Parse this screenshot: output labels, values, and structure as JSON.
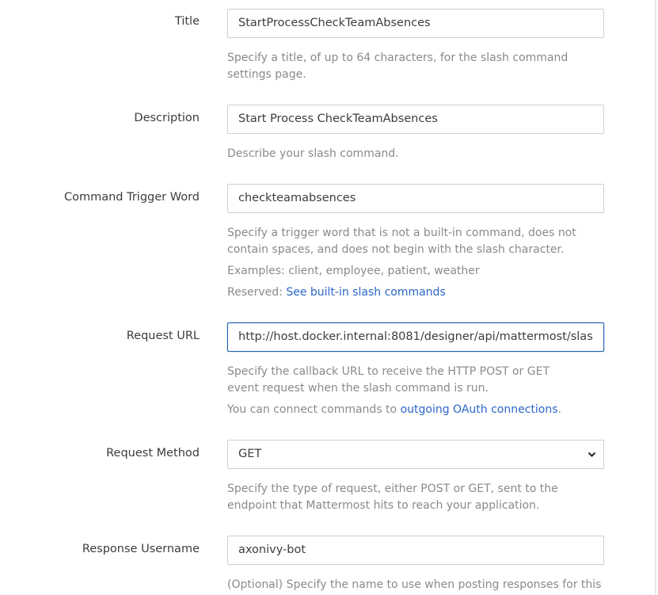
{
  "fields": {
    "title": {
      "label": "Title",
      "value": "StartProcessCheckTeamAbsences",
      "help": "Specify a title, of up to 64 characters, for the slash command settings page."
    },
    "description": {
      "label": "Description",
      "value": "Start Process CheckTeamAbsences",
      "help": "Describe your slash command."
    },
    "trigger": {
      "label": "Command Trigger Word",
      "value": "checkteamabsences",
      "help": "Specify a trigger word that is not a built-in command, does not contain spaces, and does not begin with the slash character.",
      "examples": "Examples: client, employee, patient, weather",
      "reserved_prefix": "Reserved: ",
      "reserved_link": "See built-in slash commands"
    },
    "request_url": {
      "label": "Request URL",
      "value": "http://host.docker.internal:8081/designer/api/mattermost/slas",
      "help": "Specify the callback URL to receive the HTTP POST or GET event request when the slash command is run.",
      "connect_prefix": "You can connect commands to ",
      "connect_link": "outgoing OAuth connections",
      "connect_suffix": "."
    },
    "request_method": {
      "label": "Request Method",
      "value": "GET",
      "help": "Specify the type of request, either POST or GET, sent to the endpoint that Mattermost hits to reach your application."
    },
    "response_username": {
      "label": "Response Username",
      "value": "axonivy-bot",
      "help": "(Optional) Specify the name to use when posting responses for this"
    }
  },
  "icons": {
    "select_arrow": "chevron-down-icon"
  },
  "colors": {
    "link": "#2b66c8",
    "focus_border": "#1e5fb4",
    "help_text": "#8a8a8d"
  }
}
